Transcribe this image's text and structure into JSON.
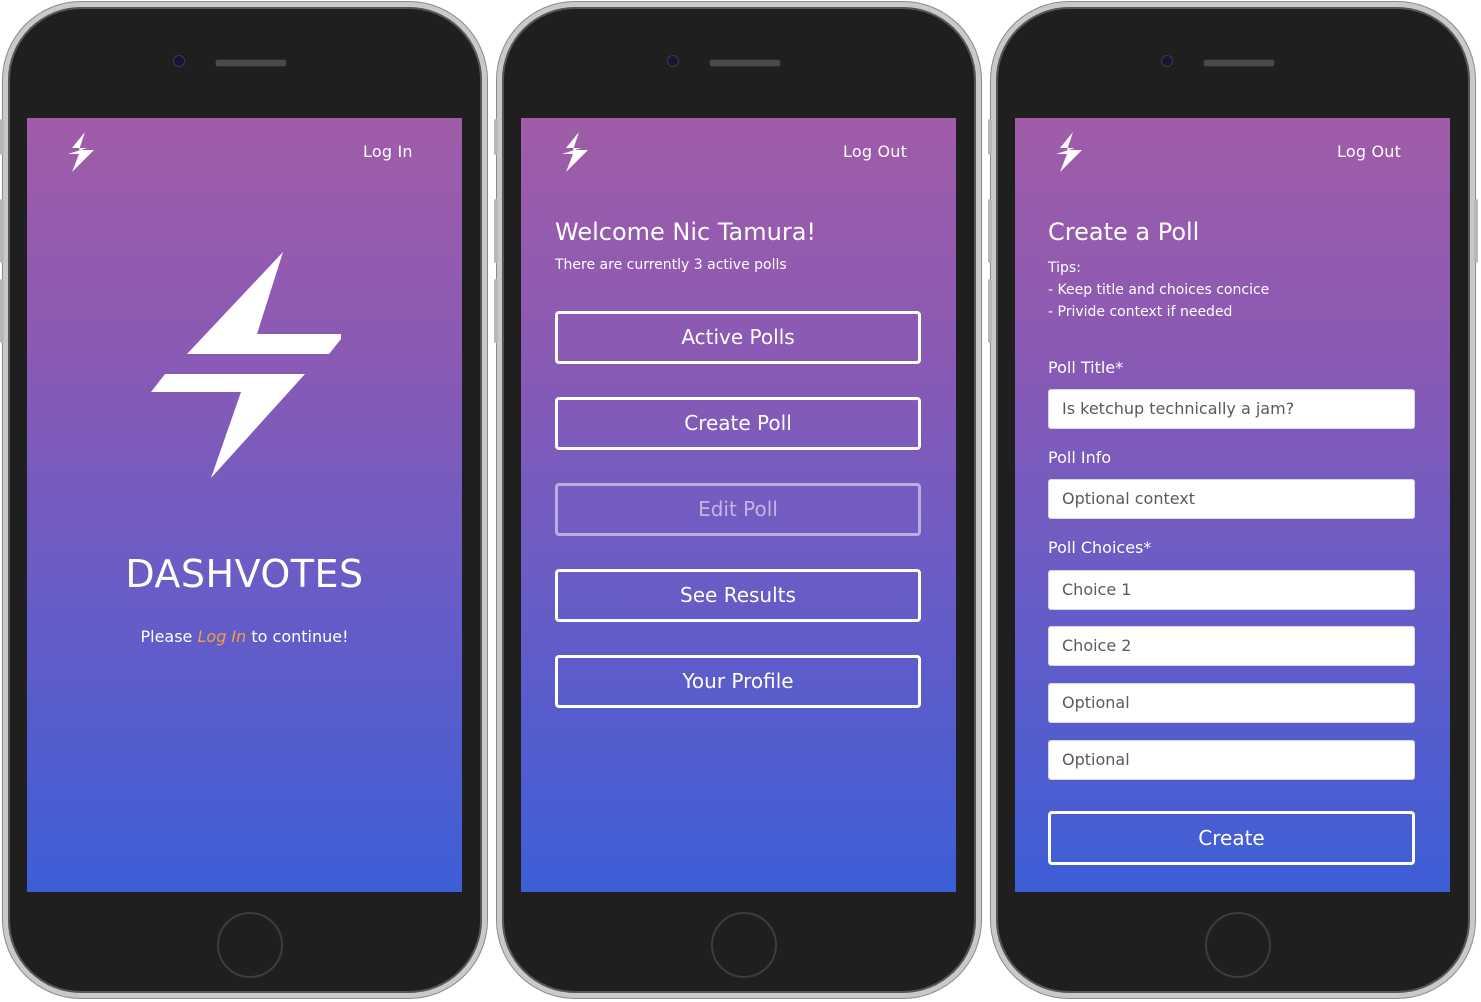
{
  "screens": {
    "login": {
      "nav_link": "Log In",
      "brand": "DASHVOTES",
      "message_before": "Please ",
      "message_link": "Log In",
      "message_after": " to continue!"
    },
    "home": {
      "nav_link": "Log Out",
      "welcome": "Welcome Nic Tamura!",
      "subtitle": "There are currently 3 active polls",
      "buttons": [
        {
          "label": "Active Polls",
          "disabled": false
        },
        {
          "label": "Create Poll",
          "disabled": false
        },
        {
          "label": "Edit Poll",
          "disabled": true
        },
        {
          "label": "See Results",
          "disabled": false
        },
        {
          "label": "Your Profile",
          "disabled": false
        }
      ]
    },
    "create": {
      "nav_link": "Log Out",
      "title": "Create a Poll",
      "tips": [
        "Tips:",
        "- Keep title and choices concice",
        "- Privide context if needed"
      ],
      "poll_title_label": "Poll Title*",
      "poll_title_value": "Is ketchup technically a jam?",
      "poll_info_label": "Poll Info",
      "poll_info_placeholder": "Optional context",
      "poll_choices_label": "Poll Choices*",
      "choices": [
        "Choice 1",
        "Choice 2",
        "Optional",
        "Optional"
      ],
      "create_label": "Create"
    }
  },
  "colors": {
    "gradient_top": "#a05ca8",
    "gradient_bottom": "#3d5ed6",
    "accent": "#f29f3d",
    "phone_body": "#1f1f1f"
  },
  "icons": [
    "lightning-bolt-icon"
  ]
}
